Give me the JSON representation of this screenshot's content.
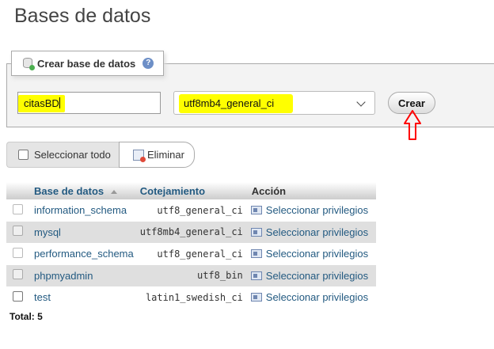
{
  "page_title": "Bases de datos",
  "create_section": {
    "legend": "Crear base de datos",
    "db_name_value": "citasBD",
    "collation_value": "utf8mb4_general_ci",
    "create_label": "Crear",
    "annotation_color": "#ff0000",
    "highlight_color": "#ffff00"
  },
  "actions": {
    "select_all_label": "Seleccionar todo",
    "delete_label": "Eliminar"
  },
  "table": {
    "headers": {
      "name": "Base de datos",
      "collation": "Cotejamiento",
      "action": "Acción"
    },
    "rows": [
      {
        "name": "information_schema",
        "collation": "utf8_general_ci",
        "action": "Seleccionar privilegios",
        "checkbox_enabled": false
      },
      {
        "name": "mysql",
        "collation": "utf8mb4_general_ci",
        "action": "Seleccionar privilegios",
        "checkbox_enabled": false
      },
      {
        "name": "performance_schema",
        "collation": "utf8_general_ci",
        "action": "Seleccionar privilegios",
        "checkbox_enabled": false
      },
      {
        "name": "phpmyadmin",
        "collation": "utf8_bin",
        "action": "Seleccionar privilegios",
        "checkbox_enabled": false
      },
      {
        "name": "test",
        "collation": "latin1_swedish_ci",
        "action": "Seleccionar privilegios",
        "checkbox_enabled": true
      }
    ]
  },
  "total": "Total: 5"
}
